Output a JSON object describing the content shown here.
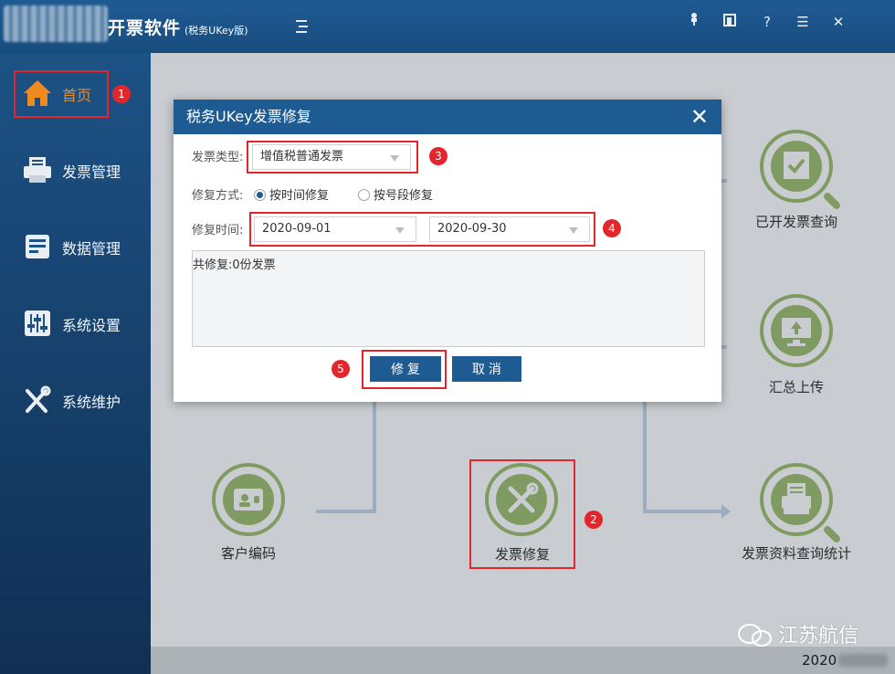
{
  "app": {
    "title": "开票软件",
    "title_suffix": "(税务UKey版)"
  },
  "sidebar": {
    "items": [
      {
        "label": "首页",
        "icon": "home-icon",
        "active": true
      },
      {
        "label": "发票管理",
        "icon": "printer-icon"
      },
      {
        "label": "数据管理",
        "icon": "database-icon"
      },
      {
        "label": "系统设置",
        "icon": "sliders-icon"
      },
      {
        "label": "系统维护",
        "icon": "wrench-screwdriver-icon"
      }
    ]
  },
  "features": {
    "issued_query": "已开发票查询",
    "summary_upload": "汇总上传",
    "customer_code": "客户编码",
    "invoice_repair": "发票修复",
    "invoice_stats": "发票资料查询统计"
  },
  "dialog": {
    "title": "税务UKey发票修复",
    "type_label": "发票类型:",
    "type_value": "增值税普通发票",
    "mode_label": "修复方式:",
    "mode_options": [
      "按时间修复",
      "按号段修复"
    ],
    "mode_selected": "按时间修复",
    "time_label": "修复时间:",
    "date_from": "2020-09-01",
    "date_to": "2020-09-30",
    "result_text": "共修复:0份发票",
    "repair_button": "修 复",
    "cancel_button": "取 消"
  },
  "annotations": [
    "1",
    "2",
    "3",
    "4",
    "5"
  ],
  "watermark": {
    "text": "江苏航信",
    "year": "2020"
  },
  "colors": {
    "primary": "#1f5b93",
    "accent_orange": "#ef8a1e",
    "icon_green": "#7f9b62",
    "highlight_red": "#e2262b"
  }
}
